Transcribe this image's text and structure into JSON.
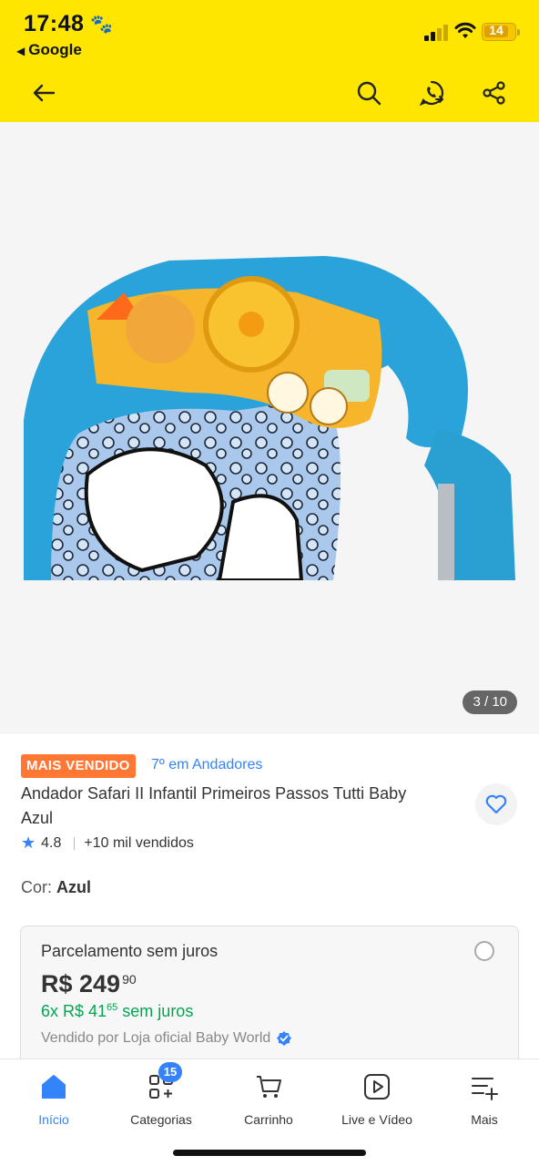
{
  "status_bar": {
    "time": "17:48",
    "back_app": "Google",
    "battery": "14"
  },
  "header": {
    "icons": [
      "back-arrow-icon",
      "search-icon",
      "whatsapp-icon",
      "share-icon"
    ]
  },
  "gallery": {
    "counter": "3 / 10",
    "image_alt": "walker-toy-tray-image"
  },
  "product": {
    "badge": "MAIS VENDIDO",
    "ranking": "7º em Andadores",
    "title": "Andador Safari II Infantil Primeiros Passos Tutti Baby Azul",
    "rating": "4.8",
    "sold": "+10 mil vendidos",
    "color_label": "Cor: ",
    "color_value": "Azul"
  },
  "price_card": {
    "title": "Parcelamento sem juros",
    "price_main": "R$ 249",
    "price_cents": "90",
    "installments_main": "6x R$ 41",
    "installments_cents": "65",
    "installments_suffix": " sem juros",
    "seller": "Vendido por Loja oficial Baby World"
  },
  "bottom_nav": {
    "cart_count": "15",
    "tabs": [
      {
        "label": "Início",
        "icon": "home-icon",
        "active": true
      },
      {
        "label": "Categorias",
        "icon": "categories-icon"
      },
      {
        "label": "Carrinho",
        "icon": "cart-icon"
      },
      {
        "label": "Live e Vídeo",
        "icon": "play-icon"
      },
      {
        "label": "Mais",
        "icon": "more-icon"
      }
    ]
  },
  "colors": {
    "header_bg": "#ffe600",
    "accent_blue": "#3483fa",
    "badge_orange": "#ff7733",
    "green": "#00a650"
  }
}
